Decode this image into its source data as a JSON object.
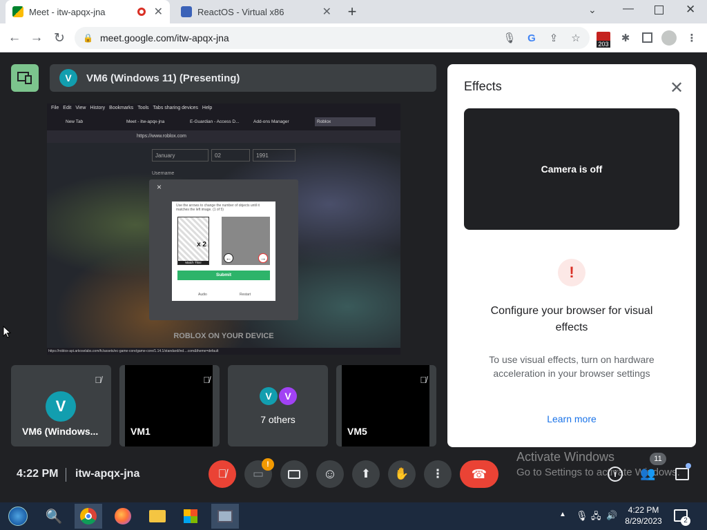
{
  "tabs": [
    {
      "title": "Meet - itw-apqx-jna",
      "active": true
    },
    {
      "title": "ReactOS - Virtual x86",
      "active": false
    }
  ],
  "address": "meet.google.com/itw-apqx-jna",
  "extension_badge": "203",
  "presentation": {
    "avatar_letter": "V",
    "title": "VM6 (Windows 11) (Presenting)"
  },
  "shared_screen": {
    "menu": [
      "File",
      "Edit",
      "View",
      "History",
      "Bookmarks",
      "Tools",
      "Tabs sharing devices",
      "Help"
    ],
    "tabs": [
      "New Tab",
      "Meet - itw-apqx-jna",
      "E-Guardian - Access D...",
      "Add-ons Manager",
      "Roblox"
    ],
    "url": "https://www.roblox.com",
    "dropdowns": [
      "January",
      "02",
      "1991"
    ],
    "username_label": "Username",
    "captcha_instruction": "Use the arrows to change the number of objects until it matches the left image. (1 of 5)",
    "captcha_left_caption": "Match This!",
    "captcha_count": "x 2",
    "submit": "Submit",
    "captcha_links": [
      "Audio",
      "Restart"
    ],
    "footer_text": "ROBLOX ON YOUR DEVICE",
    "status_url": "https://roblox-api.arkoselabs.com/fc/assets/ec-game-core/game-core/1.14.1/standard/ind....com&theme=default"
  },
  "tiles": [
    {
      "name": "VM6 (Windows...",
      "avatar": "V",
      "muted": true
    },
    {
      "name": "VM1",
      "muted": true
    },
    {
      "name": "7 others",
      "avatars": [
        "V",
        "V"
      ]
    },
    {
      "name": "VM5",
      "muted": true
    }
  ],
  "effects": {
    "title": "Effects",
    "camera_status": "Camera is off",
    "warning_glyph": "!",
    "heading": "Configure your browser for visual effects",
    "description": "To use visual effects, turn on hardware acceleration in your browser settings",
    "link": "Learn more"
  },
  "meeting": {
    "time": "4:22 PM",
    "code": "itw-apqx-jna",
    "participant_count": "11"
  },
  "watermark": {
    "line1": "Activate Windows",
    "line2": "Go to Settings to activate Windows."
  },
  "taskbar": {
    "time": "4:22 PM",
    "date": "8/29/2023",
    "notification_count": "2"
  },
  "colors": {
    "meet_green": "#7cc48d",
    "end_call_red": "#ea4335",
    "link_blue": "#1a73e8",
    "avatar_teal": "#129eaf",
    "avatar_purple": "#a142f4"
  }
}
